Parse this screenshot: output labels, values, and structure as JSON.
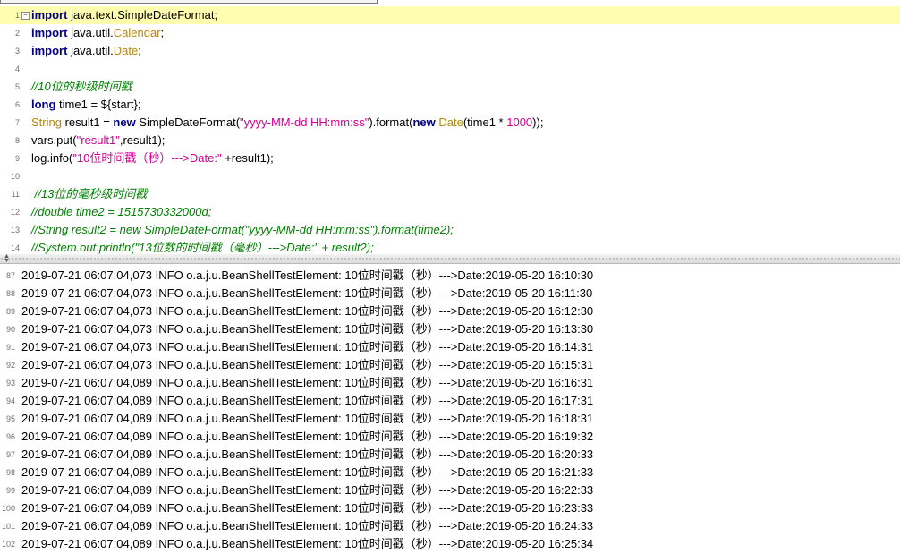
{
  "editor": {
    "lines": [
      {
        "num": "1",
        "fold": "−",
        "parts": [
          {
            "t": "import",
            "c": "kw"
          },
          {
            "t": " java.text.SimpleDateFormat;",
            "c": ""
          }
        ]
      },
      {
        "num": "2",
        "parts": [
          {
            "t": "import",
            "c": "kw"
          },
          {
            "t": " java.util.",
            "c": ""
          },
          {
            "t": "Calendar",
            "c": "cls"
          },
          {
            "t": ";",
            "c": ""
          }
        ]
      },
      {
        "num": "3",
        "parts": [
          {
            "t": "import",
            "c": "kw"
          },
          {
            "t": " java.util.",
            "c": ""
          },
          {
            "t": "Date",
            "c": "cls"
          },
          {
            "t": ";",
            "c": ""
          }
        ]
      },
      {
        "num": "4",
        "parts": []
      },
      {
        "num": "5",
        "parts": [
          {
            "t": "//10位的秒级时间戳",
            "c": "cmt"
          }
        ]
      },
      {
        "num": "6",
        "parts": [
          {
            "t": "long",
            "c": "kw"
          },
          {
            "t": " time1 = ${start};",
            "c": ""
          }
        ]
      },
      {
        "num": "7",
        "parts": [
          {
            "t": "String",
            "c": "cls"
          },
          {
            "t": " result1 = ",
            "c": ""
          },
          {
            "t": "new",
            "c": "kw"
          },
          {
            "t": " SimpleDateFormat(",
            "c": ""
          },
          {
            "t": "\"yyyy-MM-dd HH:mm:ss\"",
            "c": "str"
          },
          {
            "t": ").format(",
            "c": ""
          },
          {
            "t": "new",
            "c": "kw"
          },
          {
            "t": " ",
            "c": ""
          },
          {
            "t": "Date",
            "c": "cls"
          },
          {
            "t": "(time1 * ",
            "c": ""
          },
          {
            "t": "1000",
            "c": "num"
          },
          {
            "t": "));",
            "c": ""
          }
        ]
      },
      {
        "num": "8",
        "parts": [
          {
            "t": "vars.put(",
            "c": ""
          },
          {
            "t": "\"result1\"",
            "c": "str"
          },
          {
            "t": ",result1);",
            "c": ""
          }
        ]
      },
      {
        "num": "9",
        "parts": [
          {
            "t": "log.info(",
            "c": ""
          },
          {
            "t": "\"10位时间戳（秒）--->Date:\"",
            "c": "str"
          },
          {
            "t": " +result1);",
            "c": ""
          }
        ]
      },
      {
        "num": "10",
        "parts": []
      },
      {
        "num": "11",
        "parts": [
          {
            "t": " //13位的毫秒级时间戳",
            "c": "cmt"
          }
        ]
      },
      {
        "num": "12",
        "parts": [
          {
            "t": "//double time2 = 1515730332000d;",
            "c": "cmt"
          }
        ]
      },
      {
        "num": "13",
        "parts": [
          {
            "t": "//String result2 = new SimpleDateFormat(\"yyyy-MM-dd HH:mm:ss\").format(time2);",
            "c": "cmt"
          }
        ]
      },
      {
        "num": "14",
        "parts": [
          {
            "t": "//System.out.println(\"13位数的时间戳（毫秒）--->Date:\" + result2);",
            "c": "cmt"
          }
        ]
      }
    ]
  },
  "log": {
    "rows": [
      {
        "num": "87",
        "text": "2019-07-21 06:07:04,073 INFO o.a.j.u.BeanShellTestElement: 10位时间戳（秒）--->Date:2019-05-20 16:10:30"
      },
      {
        "num": "88",
        "text": "2019-07-21 06:07:04,073 INFO o.a.j.u.BeanShellTestElement: 10位时间戳（秒）--->Date:2019-05-20 16:11:30"
      },
      {
        "num": "89",
        "text": "2019-07-21 06:07:04,073 INFO o.a.j.u.BeanShellTestElement: 10位时间戳（秒）--->Date:2019-05-20 16:12:30"
      },
      {
        "num": "90",
        "text": "2019-07-21 06:07:04,073 INFO o.a.j.u.BeanShellTestElement: 10位时间戳（秒）--->Date:2019-05-20 16:13:30"
      },
      {
        "num": "91",
        "text": "2019-07-21 06:07:04,073 INFO o.a.j.u.BeanShellTestElement: 10位时间戳（秒）--->Date:2019-05-20 16:14:31"
      },
      {
        "num": "92",
        "text": "2019-07-21 06:07:04,073 INFO o.a.j.u.BeanShellTestElement: 10位时间戳（秒）--->Date:2019-05-20 16:15:31"
      },
      {
        "num": "93",
        "text": "2019-07-21 06:07:04,089 INFO o.a.j.u.BeanShellTestElement: 10位时间戳（秒）--->Date:2019-05-20 16:16:31"
      },
      {
        "num": "94",
        "text": "2019-07-21 06:07:04,089 INFO o.a.j.u.BeanShellTestElement: 10位时间戳（秒）--->Date:2019-05-20 16:17:31"
      },
      {
        "num": "95",
        "text": "2019-07-21 06:07:04,089 INFO o.a.j.u.BeanShellTestElement: 10位时间戳（秒）--->Date:2019-05-20 16:18:31"
      },
      {
        "num": "96",
        "text": "2019-07-21 06:07:04,089 INFO o.a.j.u.BeanShellTestElement: 10位时间戳（秒）--->Date:2019-05-20 16:19:32"
      },
      {
        "num": "97",
        "text": "2019-07-21 06:07:04,089 INFO o.a.j.u.BeanShellTestElement: 10位时间戳（秒）--->Date:2019-05-20 16:20:33"
      },
      {
        "num": "98",
        "text": "2019-07-21 06:07:04,089 INFO o.a.j.u.BeanShellTestElement: 10位时间戳（秒）--->Date:2019-05-20 16:21:33"
      },
      {
        "num": "99",
        "text": "2019-07-21 06:07:04,089 INFO o.a.j.u.BeanShellTestElement: 10位时间戳（秒）--->Date:2019-05-20 16:22:33"
      },
      {
        "num": "100",
        "text": "2019-07-21 06:07:04,089 INFO o.a.j.u.BeanShellTestElement: 10位时间戳（秒）--->Date:2019-05-20 16:23:33"
      },
      {
        "num": "101",
        "text": "2019-07-21 06:07:04,089 INFO o.a.j.u.BeanShellTestElement: 10位时间戳（秒）--->Date:2019-05-20 16:24:33"
      },
      {
        "num": "102",
        "text": "2019-07-21 06:07:04,089 INFO o.a.j.u.BeanShellTestElement: 10位时间戳（秒）--->Date:2019-05-20 16:25:34"
      }
    ]
  }
}
